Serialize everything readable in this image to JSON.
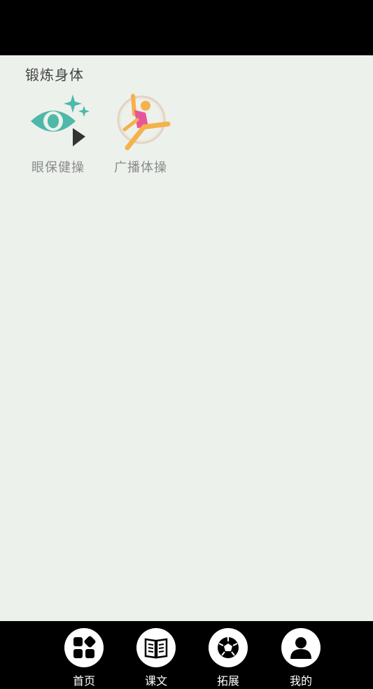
{
  "section": {
    "title": "锻炼身体"
  },
  "tiles": [
    {
      "label": "眼保健操",
      "icon": "eye-play-icon"
    },
    {
      "label": "广播体操",
      "icon": "gymnast-icon"
    }
  ],
  "tabs": [
    {
      "label": "首页",
      "icon": "grid-icon"
    },
    {
      "label": "课文",
      "icon": "book-icon"
    },
    {
      "label": "拓展",
      "icon": "ball-icon"
    },
    {
      "label": "我的",
      "icon": "user-icon"
    }
  ],
  "colors": {
    "background": "#ecf1ec",
    "eye_teal": "#4fb8a8",
    "gymnast_pink": "#e8559a",
    "gymnast_orange": "#f5b14a",
    "bar": "#000000"
  }
}
